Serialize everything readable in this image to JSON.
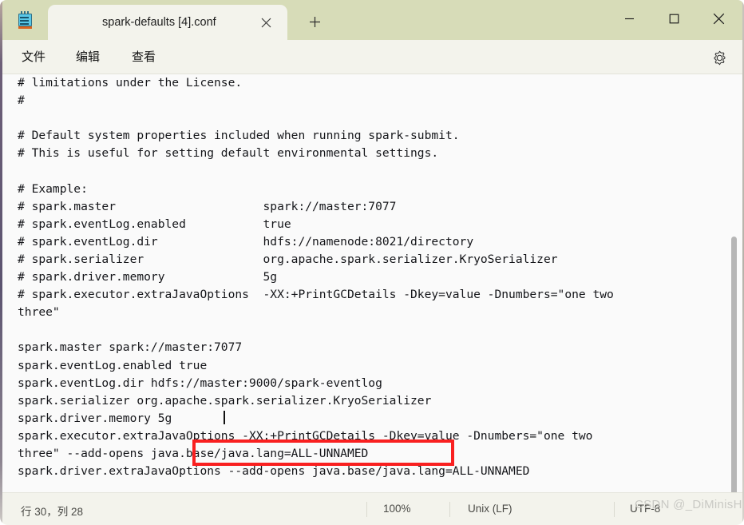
{
  "window": {
    "app_icon": "notepad-icon",
    "controls": {
      "minimize": "—",
      "maximize": "☐",
      "close": "✕"
    }
  },
  "tab": {
    "title": "spark-defaults [4].conf",
    "close_label": "✕",
    "new_tab_label": "+"
  },
  "menu": {
    "items": [
      {
        "label": "文件"
      },
      {
        "label": "编辑"
      },
      {
        "label": "查看"
      }
    ],
    "settings_icon": "gear-icon"
  },
  "editor": {
    "lines": [
      "# limitations under the License.",
      "#",
      "",
      "# Default system properties included when running spark-submit.",
      "# This is useful for setting default environmental settings.",
      "",
      "# Example:",
      "# spark.master                     spark://master:7077",
      "# spark.eventLog.enabled           true",
      "# spark.eventLog.dir               hdfs://namenode:8021/directory",
      "# spark.serializer                 org.apache.spark.serializer.KryoSerializer",
      "# spark.driver.memory              5g",
      "# spark.executor.extraJavaOptions  -XX:+PrintGCDetails -Dkey=value -Dnumbers=\"one two",
      "three\"",
      "",
      "spark.master spark://master:7077",
      "spark.eventLog.enabled true",
      "spark.eventLog.dir hdfs://master:9000/spark-eventlog",
      "spark.serializer org.apache.spark.serializer.KryoSerializer",
      "spark.driver.memory 5g",
      "spark.executor.extraJavaOptions -XX:+PrintGCDetails -Dkey=value -Dnumbers=\"one two",
      "three\" --add-opens java.base/java.lang=ALL-UNNAMED",
      "spark.driver.extraJavaOptions --add-opens java.base/java.lang=ALL-UNNAMED"
    ],
    "highlight": {
      "color": "#f92020",
      "target_text": "://master:9000/spark-eventlog"
    }
  },
  "status": {
    "position": "行 30，列 28",
    "zoom": "100%",
    "line_ending": "Unix (LF)",
    "encoding": "UTF-8"
  },
  "watermark": {
    "text": "CSDN @_DiMinisH"
  },
  "colors": {
    "titlebar": "#d7dcb8",
    "tab_active": "#f3f3ec",
    "editor_bg": "#fafafa",
    "highlight": "#f92020"
  }
}
